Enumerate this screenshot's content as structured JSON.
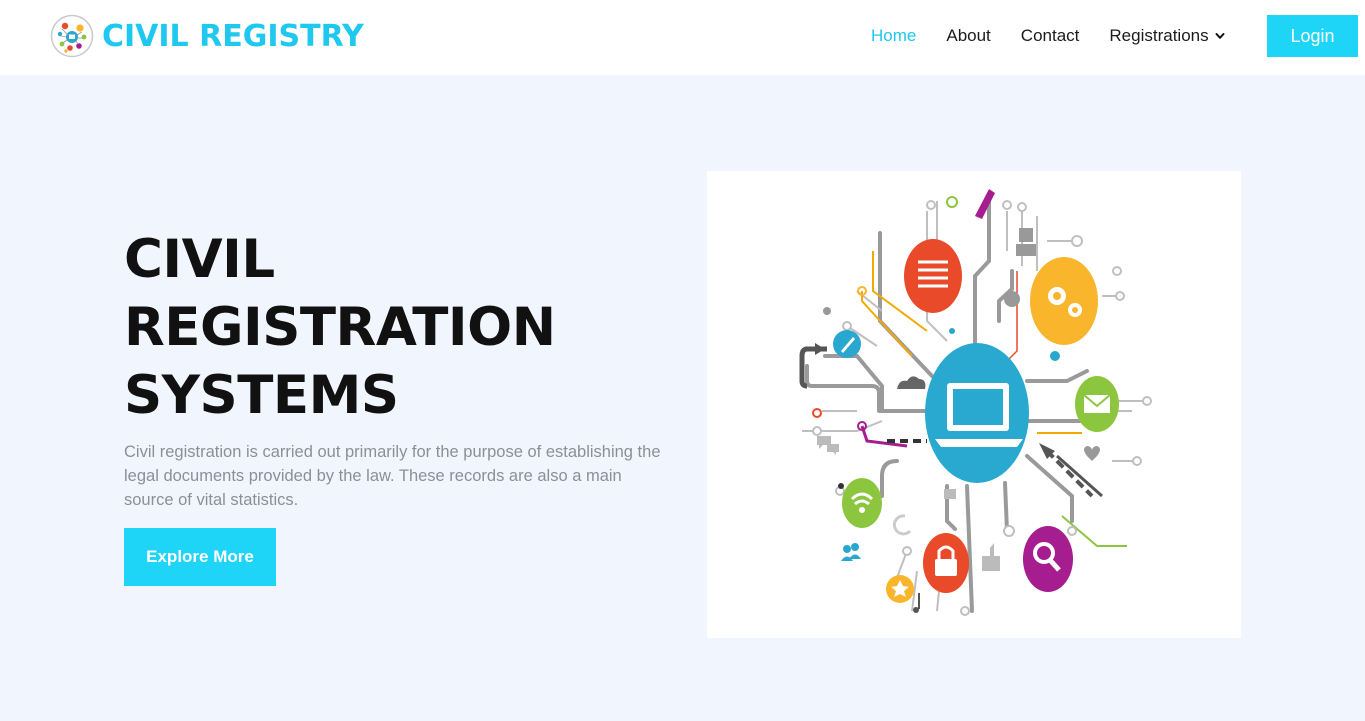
{
  "brand": {
    "name": "CIVIL REGISTRY",
    "logo_icon": "network-logo-icon"
  },
  "nav": {
    "items": [
      {
        "label": "Home",
        "active": true
      },
      {
        "label": "About",
        "active": false
      },
      {
        "label": "Contact",
        "active": false
      },
      {
        "label": "Registrations",
        "active": false,
        "dropdown": true
      }
    ],
    "login_label": "Login"
  },
  "hero": {
    "title_lines": [
      "CIVIL",
      "REGISTRATION",
      "SYSTEMS"
    ],
    "description": "Civil registration is carried out primarily for the purpose of establishing the legal documents provided by the law. These records are also a main source of vital statistics.",
    "cta_label": "Explore More",
    "image_icon": "technology-network-illustration"
  },
  "colors": {
    "accent": "#1ec8ee",
    "button": "#1ed4f7",
    "page_bg": "#f1f6fe",
    "title": "#111111",
    "muted_text": "#8a8f98"
  }
}
